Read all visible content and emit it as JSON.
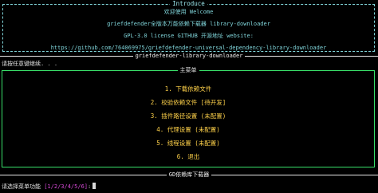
{
  "intro": {
    "title": "Introduce",
    "welcome": "欢迎使用 Welcome",
    "app_line": "griefdefender全版本万能依赖下载器 library-downloader",
    "license_line": "GPL-3.0 license GITHUB 开源地址 website:",
    "url_line": "https://github.com/764069975/griefdefender-universal-dependency-library-downloader"
  },
  "separator": {
    "title": "griefdefender-library-downloader"
  },
  "continue_prompt": "请按任意键继续. . .",
  "menu": {
    "title": "主菜单",
    "items": [
      {
        "label": "1. 下载依赖文件"
      },
      {
        "label": "2. 校验依赖文件 [待开发]"
      },
      {
        "label": "3. 插件路径设置 (未配置)"
      },
      {
        "label": "4. 代理设置 (未配置)"
      },
      {
        "label": "5. 线程设置 (未配置)"
      },
      {
        "label": "6. 退出"
      }
    ]
  },
  "footer": {
    "title": "GD依赖库下载器"
  },
  "input": {
    "prompt": "请选择菜单功能",
    "choices": "[1/2/3/4/5/6]",
    "suffix": ":"
  },
  "colors": {
    "background": "#000000",
    "intro_border": "#7fd3d8",
    "menu_border": "#39e06a",
    "menu_item": "#ffd24a",
    "choices": "#d64ad6"
  }
}
